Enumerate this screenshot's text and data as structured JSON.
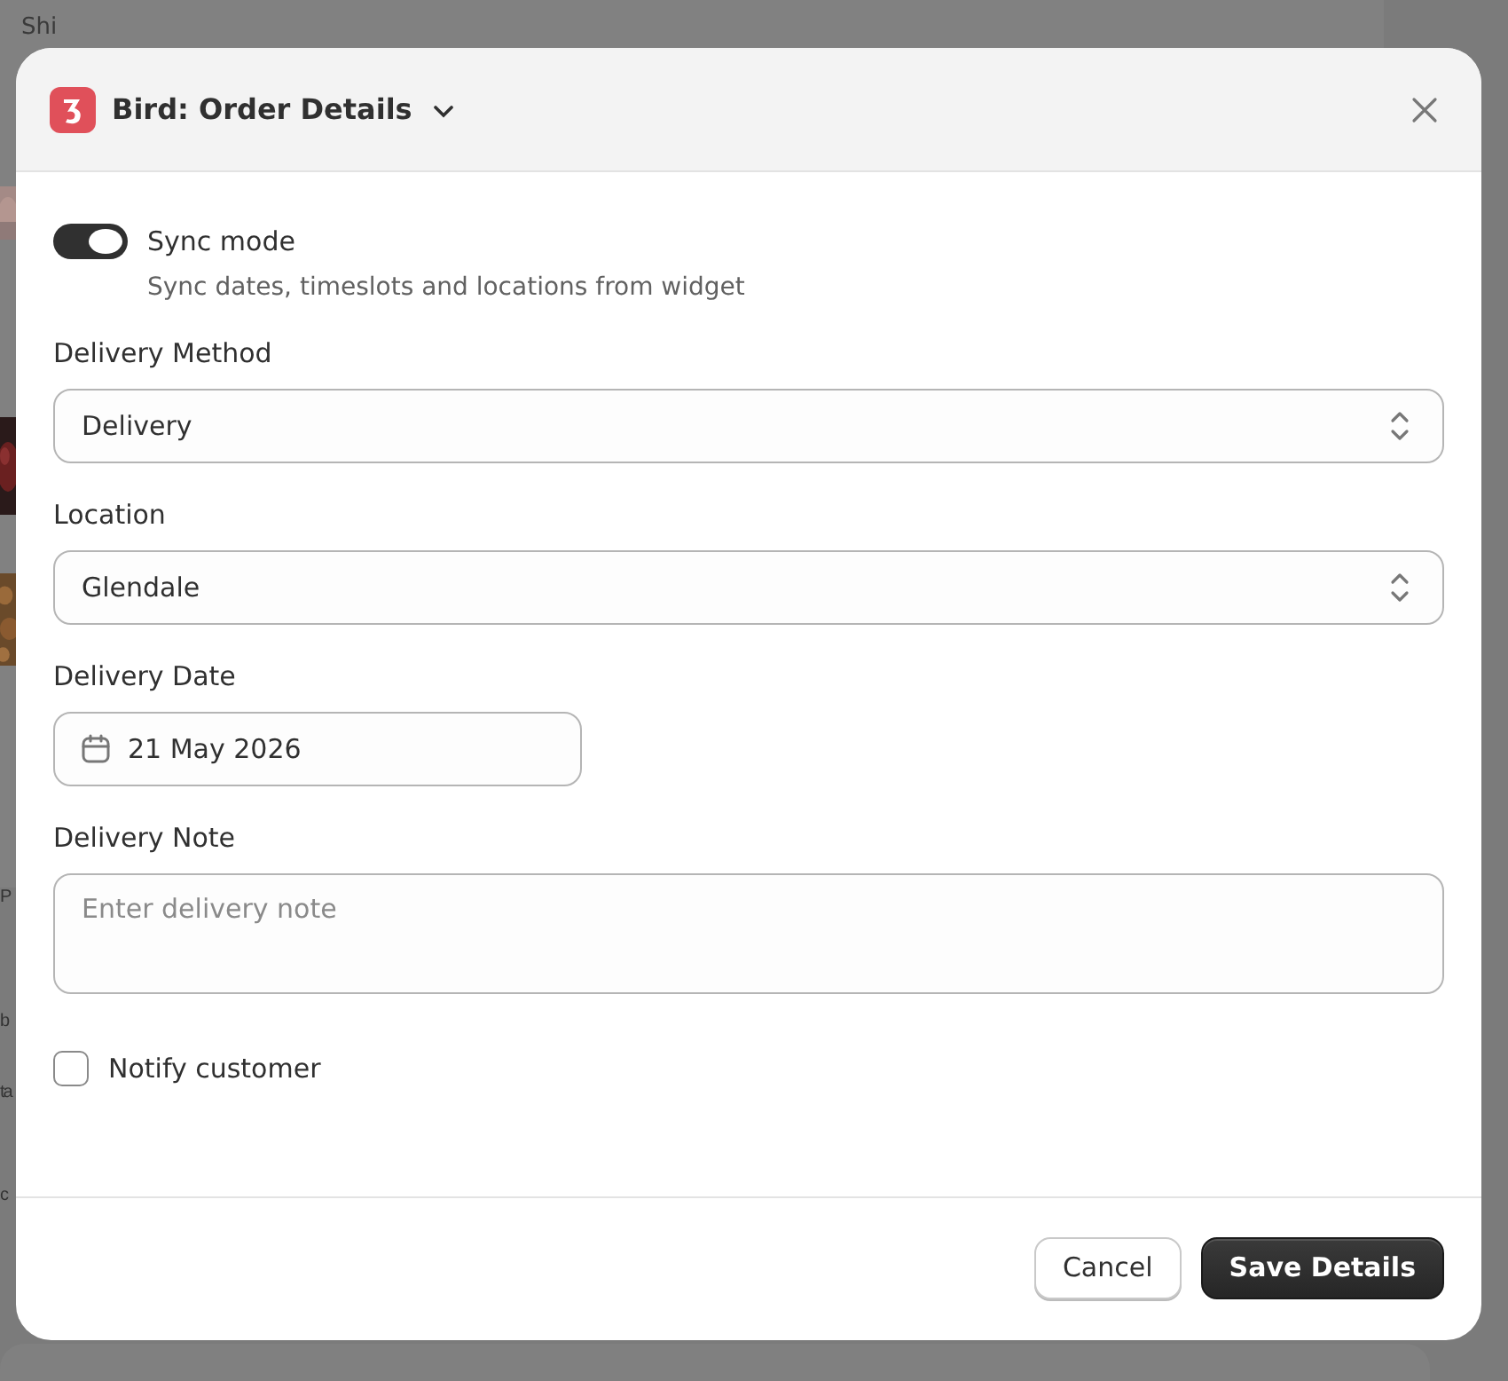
{
  "background": {
    "heading": "Shi",
    "fragments": [
      "P",
      "b",
      "ta",
      "c"
    ]
  },
  "modal": {
    "title": "Bird: Order Details",
    "sync": {
      "label": "Sync mode",
      "on": true,
      "description": "Sync dates, timeslots and locations from widget"
    },
    "fields": [
      {
        "kind": "select",
        "label": "Delivery Method",
        "value": "Delivery"
      },
      {
        "kind": "select",
        "label": "Location",
        "value": "Glendale"
      },
      {
        "kind": "date",
        "label": "Delivery Date",
        "value": "21 May 2026"
      },
      {
        "kind": "textarea",
        "label": "Delivery Note",
        "placeholder": "Enter delivery note"
      }
    ],
    "notify": {
      "label": "Notify customer",
      "checked": false
    },
    "buttons": [
      {
        "label": "Cancel",
        "kind": "secondary"
      },
      {
        "label": "Save Details",
        "kind": "primary"
      }
    ]
  }
}
